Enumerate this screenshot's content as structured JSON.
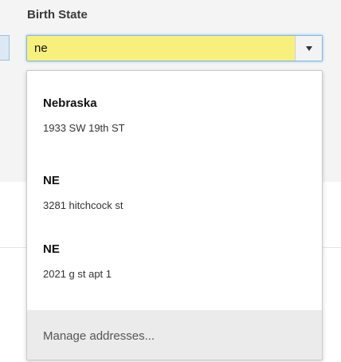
{
  "field": {
    "label": "Birth State",
    "value": "ne"
  },
  "dropdown": {
    "options": [
      {
        "title": "Nebraska",
        "address": "1933 SW 19th ST"
      },
      {
        "title": "NE",
        "address": "3281 hitchcock st"
      },
      {
        "title": "NE",
        "address": "2021 g st  apt 1"
      }
    ],
    "manage_label": "Manage addresses..."
  },
  "colors": {
    "input_background": "#f8f07c",
    "focus_border": "#80b8e6",
    "manage_background": "#ebebeb"
  },
  "icons": {
    "toggle": "chevron-down-icon"
  }
}
